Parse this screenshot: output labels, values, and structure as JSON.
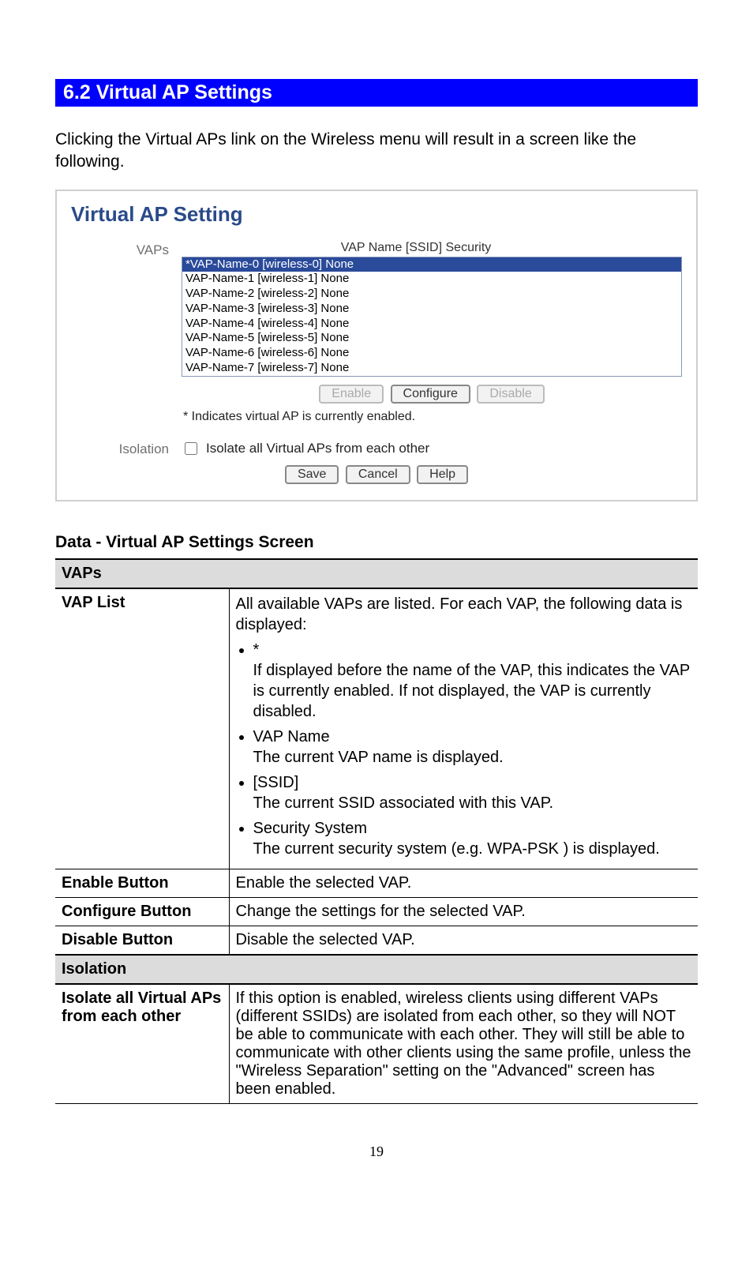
{
  "section_header": "6.2 Virtual AP Settings",
  "intro": "Clicking the Virtual APs link on the Wireless menu will result in a screen like the following.",
  "screenshot": {
    "title": "Virtual AP Setting",
    "vaps_label": "VAPs",
    "list_header": "VAP Name [SSID] Security",
    "list_items": [
      "*VAP-Name-0 [wireless-0] None",
      "VAP-Name-1 [wireless-1] None",
      "VAP-Name-2 [wireless-2] None",
      "VAP-Name-3 [wireless-3] None",
      "VAP-Name-4 [wireless-4] None",
      "VAP-Name-5 [wireless-5] None",
      "VAP-Name-6 [wireless-6] None",
      "VAP-Name-7 [wireless-7] None"
    ],
    "btn_enable": "Enable",
    "btn_configure": "Configure",
    "btn_disable": "Disable",
    "note": "* Indicates virtual AP is currently enabled.",
    "isolation_label": "Isolation",
    "isolation_checkbox_label": "Isolate all Virtual APs from each other",
    "btn_save": "Save",
    "btn_cancel": "Cancel",
    "btn_help": "Help"
  },
  "data_heading": "Data - Virtual AP Settings Screen",
  "table": {
    "vaps_section": "VAPs",
    "vap_list_label": "VAP List",
    "vap_list_intro": "All available VAPs are listed. For each VAP, the following data is displayed:",
    "vap_list_items": {
      "star": "*",
      "star_desc": "If displayed before the name of the VAP, this indicates the VAP is currently enabled. If not displayed, the VAP is currently disabled.",
      "vapname": "VAP Name",
      "vapname_desc": "The current VAP name is displayed.",
      "ssid": "[SSID]",
      "ssid_desc": "The current SSID associated with this VAP.",
      "sec": "Security System",
      "sec_desc": "The current security system (e.g. WPA-PSK ) is displayed."
    },
    "enable_label": "Enable Button",
    "enable_desc": "Enable the selected VAP.",
    "configure_label": "Configure Button",
    "configure_desc": "Change the settings for the selected VAP.",
    "disable_label": "Disable Button",
    "disable_desc": "Disable the selected VAP.",
    "isolation_section": "Isolation",
    "isolate_label": "Isolate all Virtual APs from each other",
    "isolate_desc": "If this option is enabled, wireless clients using different VAPs (different SSIDs) are isolated from each other, so they will NOT be able to communicate with each other. They will still be able to communicate with other clients using the same profile, unless the \"Wireless Separation\" setting on the \"Advanced\" screen has been enabled."
  },
  "page_number": "19"
}
